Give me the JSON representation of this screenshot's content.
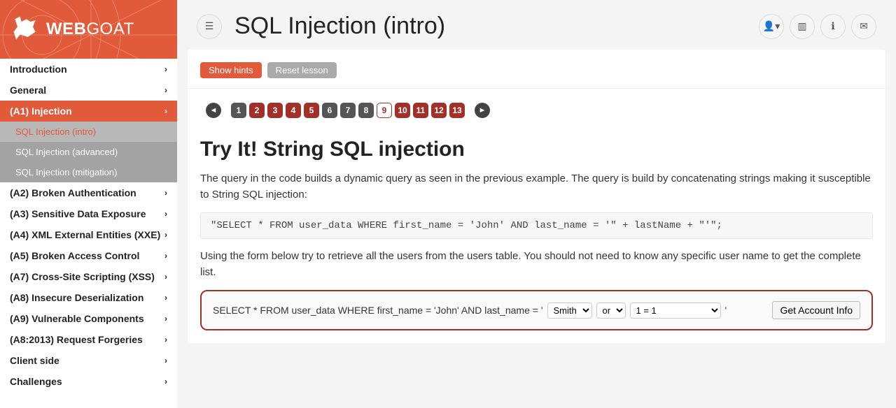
{
  "brand": {
    "part1": "WEB",
    "part2": "GOAT"
  },
  "nav": {
    "items": [
      {
        "label": "Introduction"
      },
      {
        "label": "General"
      },
      {
        "label": "(A1) Injection",
        "active": true
      },
      {
        "label": "(A2) Broken Authentication"
      },
      {
        "label": "(A3) Sensitive Data Exposure"
      },
      {
        "label": "(A4) XML External Entities (XXE)"
      },
      {
        "label": "(A5) Broken Access Control"
      },
      {
        "label": "(A7) Cross-Site Scripting (XSS)"
      },
      {
        "label": "(A8) Insecure Deserialization"
      },
      {
        "label": "(A9) Vulnerable Components"
      },
      {
        "label": "(A8:2013) Request Forgeries"
      },
      {
        "label": "Client side"
      },
      {
        "label": "Challenges"
      }
    ],
    "sub": [
      {
        "label": "SQL Injection (intro)",
        "current": true
      },
      {
        "label": "SQL Injection (advanced)"
      },
      {
        "label": "SQL Injection (mitigation)"
      }
    ]
  },
  "page": {
    "title": "SQL Injection (intro)"
  },
  "buttons": {
    "show_hints": "Show hints",
    "reset_lesson": "Reset lesson"
  },
  "pager": {
    "pages": [
      {
        "n": "1",
        "state": "done"
      },
      {
        "n": "2",
        "state": ""
      },
      {
        "n": "3",
        "state": ""
      },
      {
        "n": "4",
        "state": ""
      },
      {
        "n": "5",
        "state": ""
      },
      {
        "n": "6",
        "state": "done"
      },
      {
        "n": "7",
        "state": "done"
      },
      {
        "n": "8",
        "state": "done"
      },
      {
        "n": "9",
        "state": "current"
      },
      {
        "n": "10",
        "state": ""
      },
      {
        "n": "11",
        "state": ""
      },
      {
        "n": "12",
        "state": ""
      },
      {
        "n": "13",
        "state": ""
      }
    ]
  },
  "lesson": {
    "heading": "Try It! String SQL injection",
    "p1": "The query in the code builds a dynamic query as seen in the previous example. The query is build by concatenating strings making it susceptible to String SQL injection:",
    "code": "\"SELECT * FROM user_data WHERE first_name = 'John' AND last_name = '\" + lastName + \"'\";",
    "p2": "Using the form below try to retrieve all the users from the users table. You should not need to know any specific user name to get the complete list."
  },
  "attack": {
    "sql_prefix": "SELECT * FROM user_data WHERE first_name = 'John' AND last_name = '",
    "select1": {
      "value": "Smith",
      "options": [
        "Smith"
      ]
    },
    "select2": {
      "value": "or",
      "options": [
        "or"
      ]
    },
    "select3": {
      "value": "1 = 1",
      "options": [
        "1 = 1"
      ]
    },
    "sql_suffix": "'",
    "submit": "Get Account Info"
  }
}
